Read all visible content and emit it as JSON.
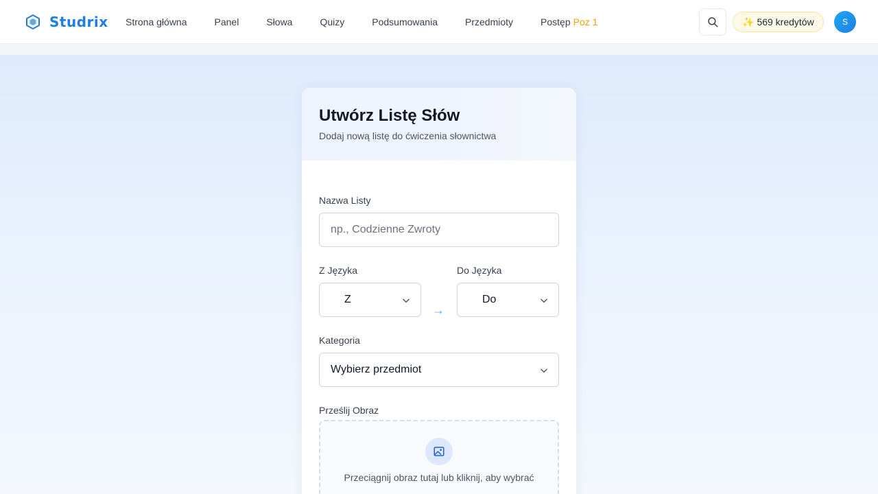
{
  "brand": {
    "name": "Studrix"
  },
  "nav": {
    "items": [
      {
        "label": "Strona główna"
      },
      {
        "label": "Panel"
      },
      {
        "label": "Słowa"
      },
      {
        "label": "Quizy"
      },
      {
        "label": "Podsumowania"
      },
      {
        "label": "Przedmioty"
      },
      {
        "label": "Postęp",
        "badge": "Poz 1"
      }
    ]
  },
  "header": {
    "credits_icon": "✨",
    "credits": "569 kredytów",
    "avatar_initial": "S"
  },
  "form": {
    "title": "Utwórz Listę Słów",
    "subtitle": "Dodaj nową listę do ćwiczenia słownictwa",
    "list_name": {
      "label": "Nazwa Listy",
      "placeholder": "np., Codzienne Zwroty",
      "value": ""
    },
    "from_lang": {
      "label": "Z Języka",
      "value": "Z"
    },
    "arrow": "→",
    "to_lang": {
      "label": "Do Języka",
      "value": "Do"
    },
    "category": {
      "label": "Kategoria",
      "value": "Wybierz przedmiot"
    },
    "upload": {
      "label": "Prześlij Obraz",
      "hint": "Przeciągnij obraz tutaj lub kliknij, aby wybrać"
    }
  },
  "colors": {
    "brand": "#1d7fe6",
    "accent_badge": "#f59e0b",
    "credits_bg": "#fef9e7"
  }
}
